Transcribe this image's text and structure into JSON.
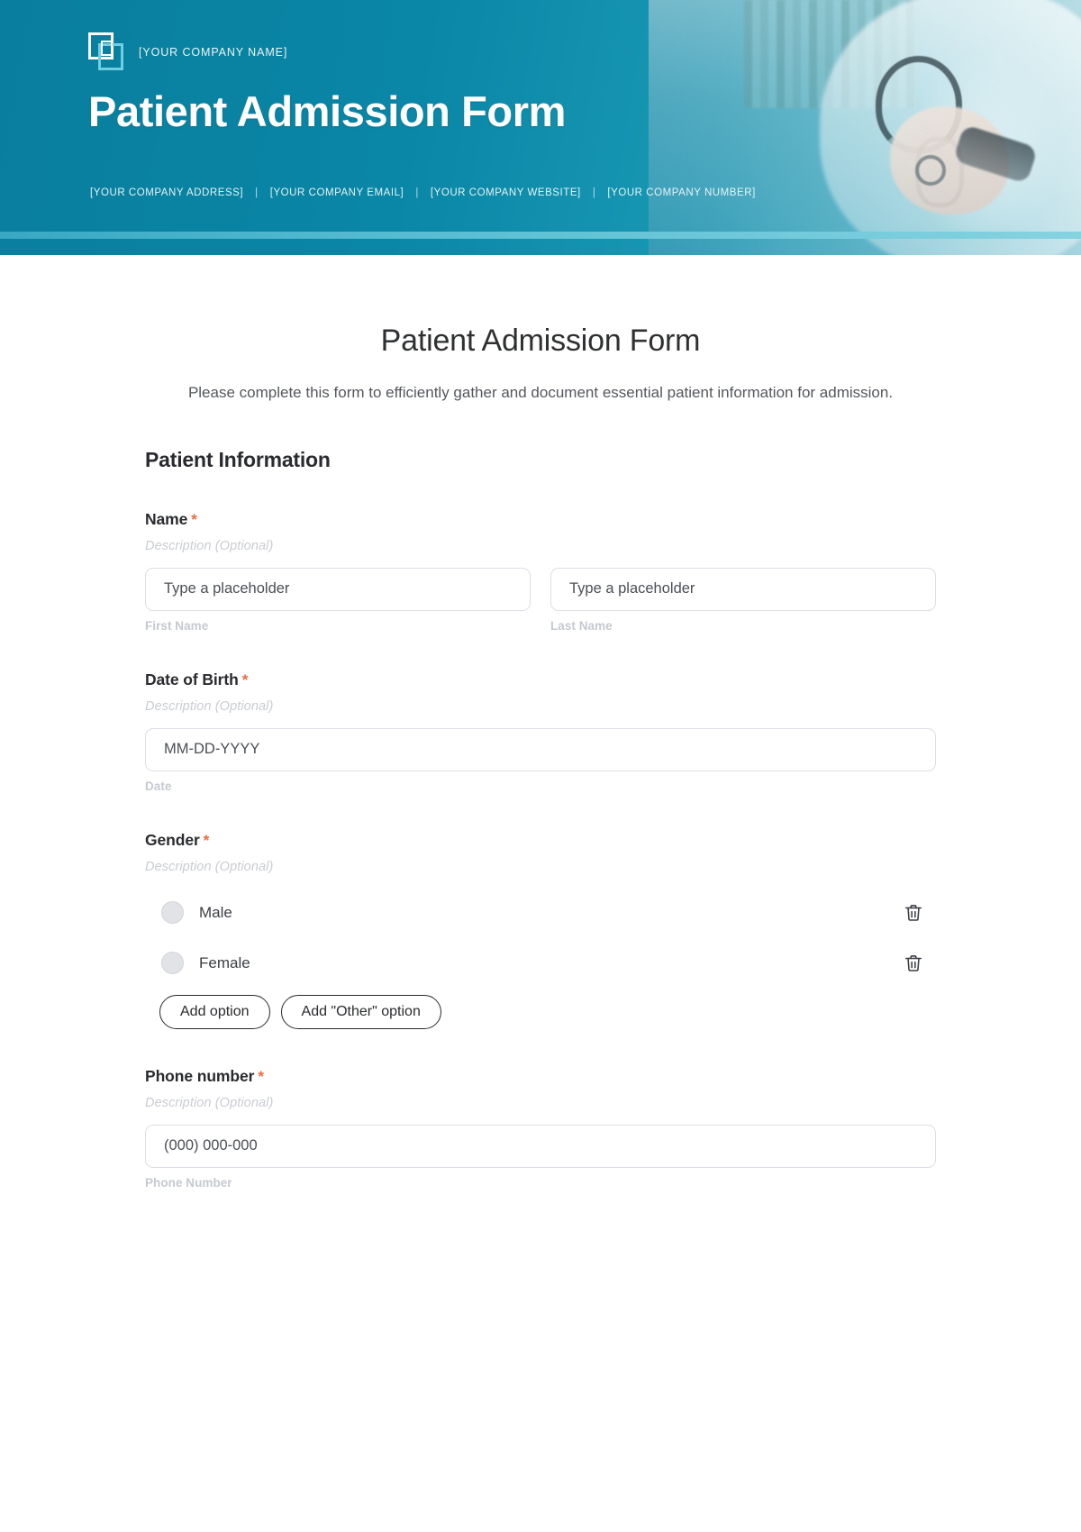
{
  "banner": {
    "logo_icon": "overlapping-squares-logo",
    "company_name": "[YOUR COMPANY NAME]",
    "title": "Patient Admission Form",
    "contacts": [
      "[YOUR COMPANY ADDRESS]",
      "[YOUR COMPANY EMAIL]",
      "[YOUR COMPANY WEBSITE]",
      "[YOUR COMPANY NUMBER]"
    ],
    "separator": "|",
    "colors": {
      "banner_teal": "#0a86a6",
      "banner_light": "#9ed2dd",
      "underline": "#5cc0d4",
      "logo_white": "#ffffff",
      "logo_blue": "#6fd0e4"
    }
  },
  "form": {
    "title": "Patient Admission Form",
    "subtitle": "Please complete this form to efficiently gather and document essential patient information for admission.",
    "section_title": "Patient Information",
    "required_marker": "*",
    "description_placeholder": "Description (Optional)",
    "colors": {
      "required_red": "#f3693f",
      "label_dark": "#2a2b2e",
      "muted": "#c5c9d0"
    },
    "fields": {
      "name": {
        "label": "Name",
        "description": "Description (Optional)",
        "first": {
          "placeholder": "Type a placeholder",
          "value": "Type a placeholder",
          "sub_label": "First Name"
        },
        "last": {
          "placeholder": "Type a placeholder",
          "value": "Type a placeholder",
          "sub_label": "Last Name"
        }
      },
      "date_of_birth": {
        "label": "Date of Birth",
        "description": "Description (Optional)",
        "placeholder": "MM-DD-YYYY",
        "value": "MM-DD-YYYY",
        "sub_label": "Date"
      },
      "gender": {
        "label": "Gender",
        "description": "Description (Optional)",
        "options": [
          {
            "label": "Male",
            "delete_icon": "trash-icon"
          },
          {
            "label": "Female",
            "delete_icon": "trash-icon"
          }
        ],
        "add_option_label": "Add option",
        "add_other_label": "Add \"Other\" option"
      },
      "phone": {
        "label": "Phone number",
        "description": "Description (Optional)",
        "placeholder": "(000) 000-000",
        "value": "(000) 000-000",
        "sub_label": "Phone Number"
      }
    }
  }
}
